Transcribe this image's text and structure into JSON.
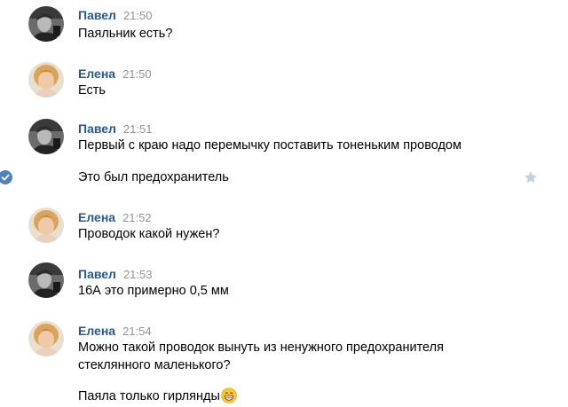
{
  "messages": [
    {
      "author": "Павел",
      "time": "21:50",
      "lines": [
        "Паяльник есть?"
      ]
    },
    {
      "author": "Елена",
      "time": "21:50",
      "lines": [
        "Есть"
      ]
    },
    {
      "author": "Павел",
      "time": "21:51",
      "lines": [
        "Первый с краю надо перемычку поставить тоненьким проводом",
        "Это был предохранитель"
      ]
    },
    {
      "author": "Елена",
      "time": "21:52",
      "lines": [
        "Проводок какой нужен?"
      ]
    },
    {
      "author": "Павел",
      "time": "21:53",
      "lines": [
        "16А это примерно 0,5 мм"
      ]
    },
    {
      "author": "Елена",
      "time": "21:54",
      "lines": [
        "Можно такой проводок вынуть из ненужного предохранителя",
        "стеклянного маленького?",
        "Паяла только гирлянды"
      ]
    }
  ],
  "icons": {
    "selected_check": "check-circle-icon",
    "favorite": "star-icon",
    "emoji": "grinning-face-emoji"
  },
  "colors": {
    "author_name": "#2a5885",
    "timestamp": "#939393",
    "check_circle": "#5181b8",
    "star": "#c5d0db"
  }
}
